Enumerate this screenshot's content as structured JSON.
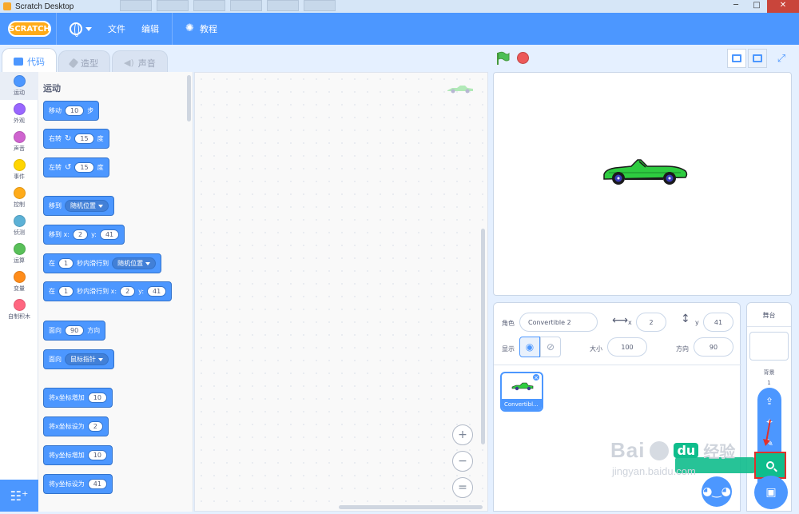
{
  "window": {
    "title": "Scratch Desktop",
    "minimize": "─",
    "maximize": "□",
    "close": "✕"
  },
  "menubar": {
    "logo": "SCRATCH",
    "file": "文件",
    "edit": "编辑",
    "tutorials": "教程"
  },
  "tabs": {
    "code": "代码",
    "costumes": "造型",
    "sounds": "声音"
  },
  "categories": [
    {
      "label": "运动",
      "color": "#4c97ff"
    },
    {
      "label": "外观",
      "color": "#9966ff"
    },
    {
      "label": "声音",
      "color": "#cf63cf"
    },
    {
      "label": "事件",
      "color": "#ffd500"
    },
    {
      "label": "控制",
      "color": "#ffab19"
    },
    {
      "label": "侦测",
      "color": "#5cb1d6"
    },
    {
      "label": "运算",
      "color": "#59c059"
    },
    {
      "label": "变量",
      "color": "#ff8c1a"
    },
    {
      "label": "自制积木",
      "color": "#ff6680"
    }
  ],
  "palette": {
    "heading": "运动",
    "move": {
      "a": "移动",
      "n": "10",
      "b": "步"
    },
    "turn_right": {
      "a": "右转",
      "icon": "↻",
      "n": "15",
      "b": "度"
    },
    "turn_left": {
      "a": "左转",
      "icon": "↺",
      "n": "15",
      "b": "度"
    },
    "goto": {
      "a": "移到",
      "opt": "随机位置"
    },
    "goto_xy": {
      "a": "移到 x:",
      "x": "2",
      "ylabel": "y:",
      "y": "41"
    },
    "glide": {
      "a": "在",
      "n": "1",
      "b": "秒内滑行到",
      "opt": "随机位置"
    },
    "glide_xy": {
      "a": "在",
      "n": "1",
      "b": "秒内滑行到 x:",
      "x": "2",
      "ylabel": "y:",
      "y": "41"
    },
    "point_dir": {
      "a": "面向",
      "n": "90",
      "b": "方向"
    },
    "point_towards": {
      "a": "面向",
      "opt": "鼠标指针"
    },
    "change_x": {
      "a": "将x坐标增加",
      "n": "10"
    },
    "set_x": {
      "a": "将x坐标设为",
      "n": "2"
    },
    "change_y": {
      "a": "将y坐标增加",
      "n": "10"
    },
    "set_y": {
      "a": "将y坐标设为",
      "n": "41"
    }
  },
  "zoom": {
    "in": "+",
    "out": "−",
    "reset": "="
  },
  "sprite_info": {
    "sprite_label": "角色",
    "sprite_name": "Convertible 2",
    "x_label": "x",
    "x": "2",
    "y_label": "y",
    "y": "41",
    "show_label": "显示",
    "size_label": "大小",
    "size": "100",
    "dir_label": "方向",
    "direction": "90"
  },
  "sprites": [
    {
      "name": "Convertibl..."
    }
  ],
  "stage_pane": {
    "title": "舞台",
    "backdrops_label": "背景",
    "backdrops_count": "1"
  },
  "watermark": {
    "brand": "Bai",
    "du": "du",
    "jy": "经验",
    "url": "jingyan.baidu.com"
  },
  "colors": {
    "accent": "#4c97ff",
    "menubar": "#4c97ff",
    "search_highlight": "#0fbd8c",
    "annotation": "#e0312b",
    "car": "#2ecc40"
  }
}
